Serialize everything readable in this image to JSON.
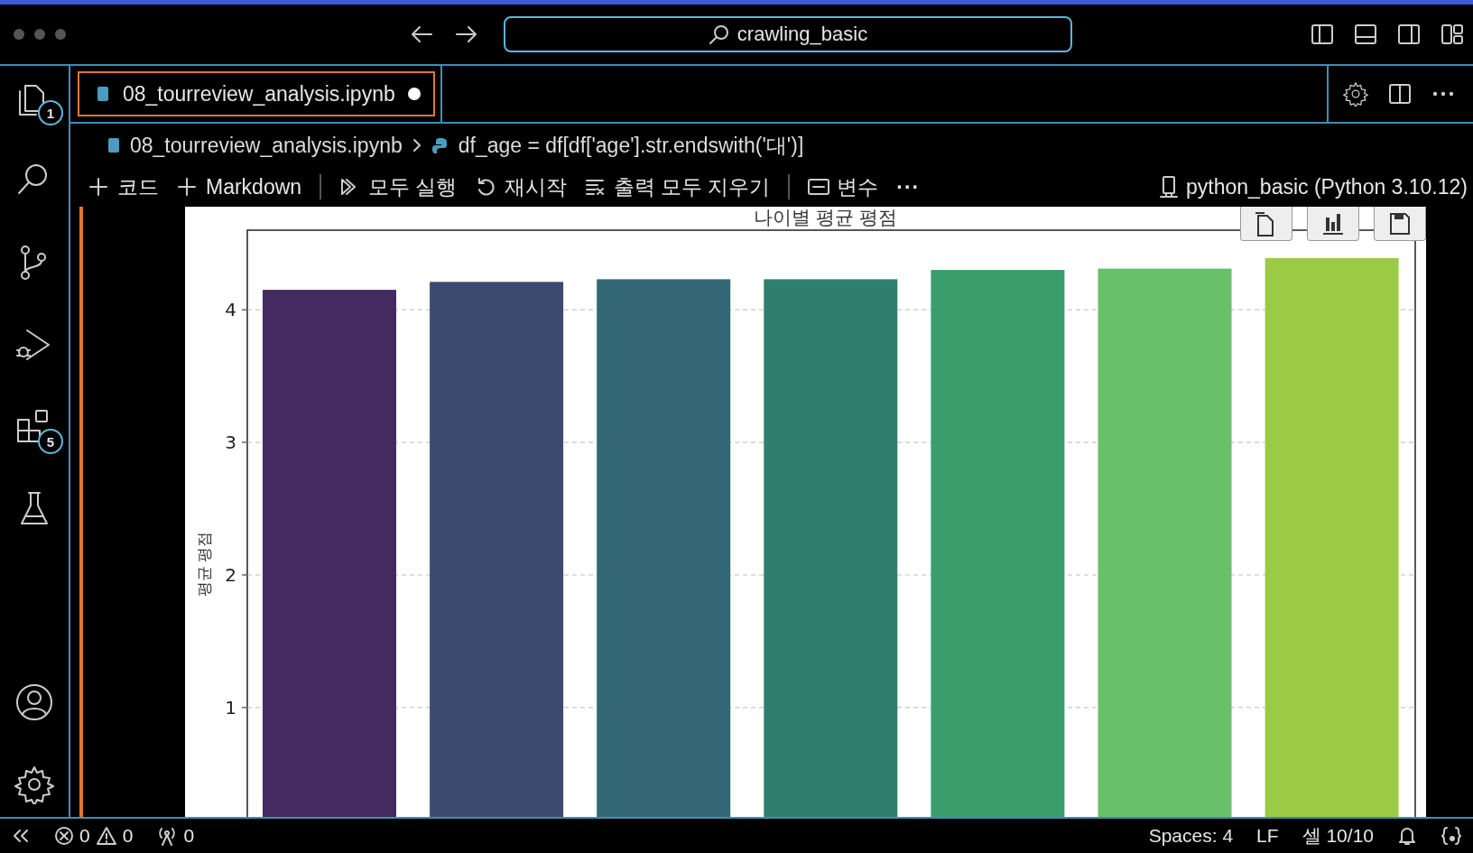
{
  "window": {
    "search": "crawling_basic"
  },
  "activity_bar": [
    {
      "kind": "files",
      "badge": "1"
    },
    {
      "kind": "search"
    },
    {
      "kind": "source-control"
    },
    {
      "kind": "run"
    },
    {
      "kind": "extensions",
      "badge": "5"
    },
    {
      "kind": "testing"
    },
    {
      "kind": "account"
    },
    {
      "kind": "settings"
    }
  ],
  "tabs": [
    {
      "label": "08_tourreview_analysis.ipynb",
      "selected": true,
      "dirty": true
    }
  ],
  "breadcrumb": [
    "08_tourreview_analysis.ipynb",
    "df_age = df[df['age'].str.endswith('대')]"
  ],
  "toolbar": [
    {
      "kind": "add",
      "label": "코드"
    },
    {
      "kind": "add",
      "label": "Markdown"
    },
    {
      "kind": "sep"
    },
    {
      "kind": "run-all",
      "label": "모두 실행"
    },
    {
      "kind": "restart",
      "label": "재시작"
    },
    {
      "kind": "clear",
      "label": "출력 모두 지우기"
    },
    {
      "kind": "sep"
    },
    {
      "kind": "variables",
      "label": "변수"
    },
    {
      "kind": "more",
      "label": "···"
    }
  ],
  "kernel": "python_basic (Python 3.10.12)",
  "output": {
    "chart_data": {
      "type": "bar",
      "title": "나이별 평균 평점",
      "ylabel": "평균 평점",
      "ylim": [
        0,
        4.6
      ],
      "yticks": [
        1,
        2,
        3,
        4
      ],
      "grid": true,
      "series": [
        {
          "values": [
            4.15,
            4.21,
            4.23,
            4.23,
            4.3,
            4.31,
            4.39
          ]
        }
      ],
      "colors": [
        "#432a61",
        "#3d4a70",
        "#336775",
        "#2e7f6f",
        "#3a9e6c",
        "#68c06a",
        "#9bca44"
      ]
    }
  },
  "status_bar": {
    "errors": "0",
    "warnings": "0",
    "ports": "0",
    "items": [
      "Spaces: 4",
      "LF",
      "셀 10/10"
    ]
  }
}
